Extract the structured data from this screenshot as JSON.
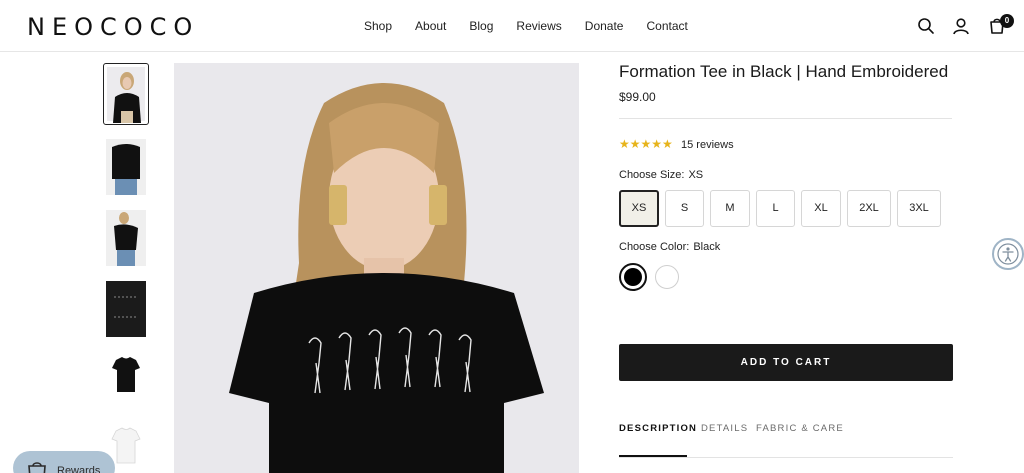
{
  "brand": {
    "logo": "NEOCOCO"
  },
  "nav": {
    "items": [
      "Shop",
      "About",
      "Blog",
      "Reviews",
      "Donate",
      "Contact"
    ]
  },
  "header": {
    "cart_count": "0",
    "icons": [
      "search-icon",
      "account-icon",
      "cart-icon"
    ]
  },
  "product": {
    "title": "Formation Tee in Black | Hand Embroidered",
    "price": "$99.00",
    "rating": {
      "stars": "★★★★★",
      "reviews_label": "15 reviews"
    },
    "size": {
      "label": "Choose Size:",
      "selected": "XS",
      "options": [
        "XS",
        "S",
        "M",
        "L",
        "XL",
        "2XL",
        "3XL"
      ]
    },
    "color": {
      "label": "Choose Color:",
      "selected": "Black",
      "options": [
        {
          "name": "Black",
          "hex": "#000000"
        },
        {
          "name": "White",
          "hex": "#ffffff"
        }
      ]
    },
    "add_to_cart": "ADD TO CART",
    "tabs": [
      "DESCRIPTION",
      "DETAILS",
      "FABRIC & CARE"
    ],
    "thumbnails": [
      "model-front",
      "model-front-2",
      "model-side",
      "flat-black-folded",
      "flat-black-tee",
      "flat-white-tee"
    ]
  },
  "widgets": {
    "rewards_label": "Rewards",
    "accessibility": "accessibility-icon"
  },
  "colors": {
    "accent": "#1a1a1a",
    "star": "#e7b41b",
    "rewards_bg": "#aec3d4"
  }
}
